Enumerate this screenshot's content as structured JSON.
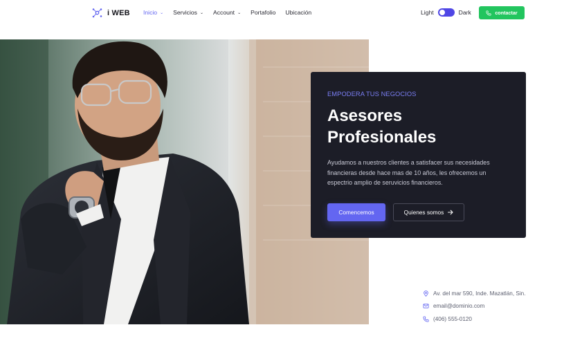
{
  "brand": {
    "name": "i WEB",
    "icon": "network-logo-icon"
  },
  "nav": {
    "items": [
      {
        "label": "Inicio",
        "dropdown": true,
        "active": true
      },
      {
        "label": "Servicios",
        "dropdown": true,
        "active": false
      },
      {
        "label": "Account",
        "dropdown": true,
        "active": false
      },
      {
        "label": "Portafolio",
        "dropdown": false,
        "active": false
      },
      {
        "label": "Ubicación",
        "dropdown": false,
        "active": false
      }
    ],
    "chevron": "⌄"
  },
  "theme": {
    "light_label": "Light",
    "dark_label": "Dark"
  },
  "cta": {
    "label": "contactar",
    "icon": "phone-icon"
  },
  "hero": {
    "eyebrow": "EMPODERA TUS NEGOCIOS",
    "title": "Asesores Profesionales",
    "description": "Ayudamos a nuestros clientes a satisfacer sus necesidades financieras desde hace mas de 10 años, les ofrecemos un espectrio amplio de seruvicios financieros.",
    "primary_button": "Comencemos",
    "secondary_button": "Quienes somos",
    "secondary_icon": "arrow-right-icon"
  },
  "contact_info": {
    "address": "Av. del mar 590, Inde. Mazatlán, Sin.",
    "email": "email@dominio.com",
    "phone": "(406) 555-0120"
  },
  "colors": {
    "accent": "#6366f1",
    "cta_green": "#22c55e",
    "card_bg": "#1c1d27"
  }
}
